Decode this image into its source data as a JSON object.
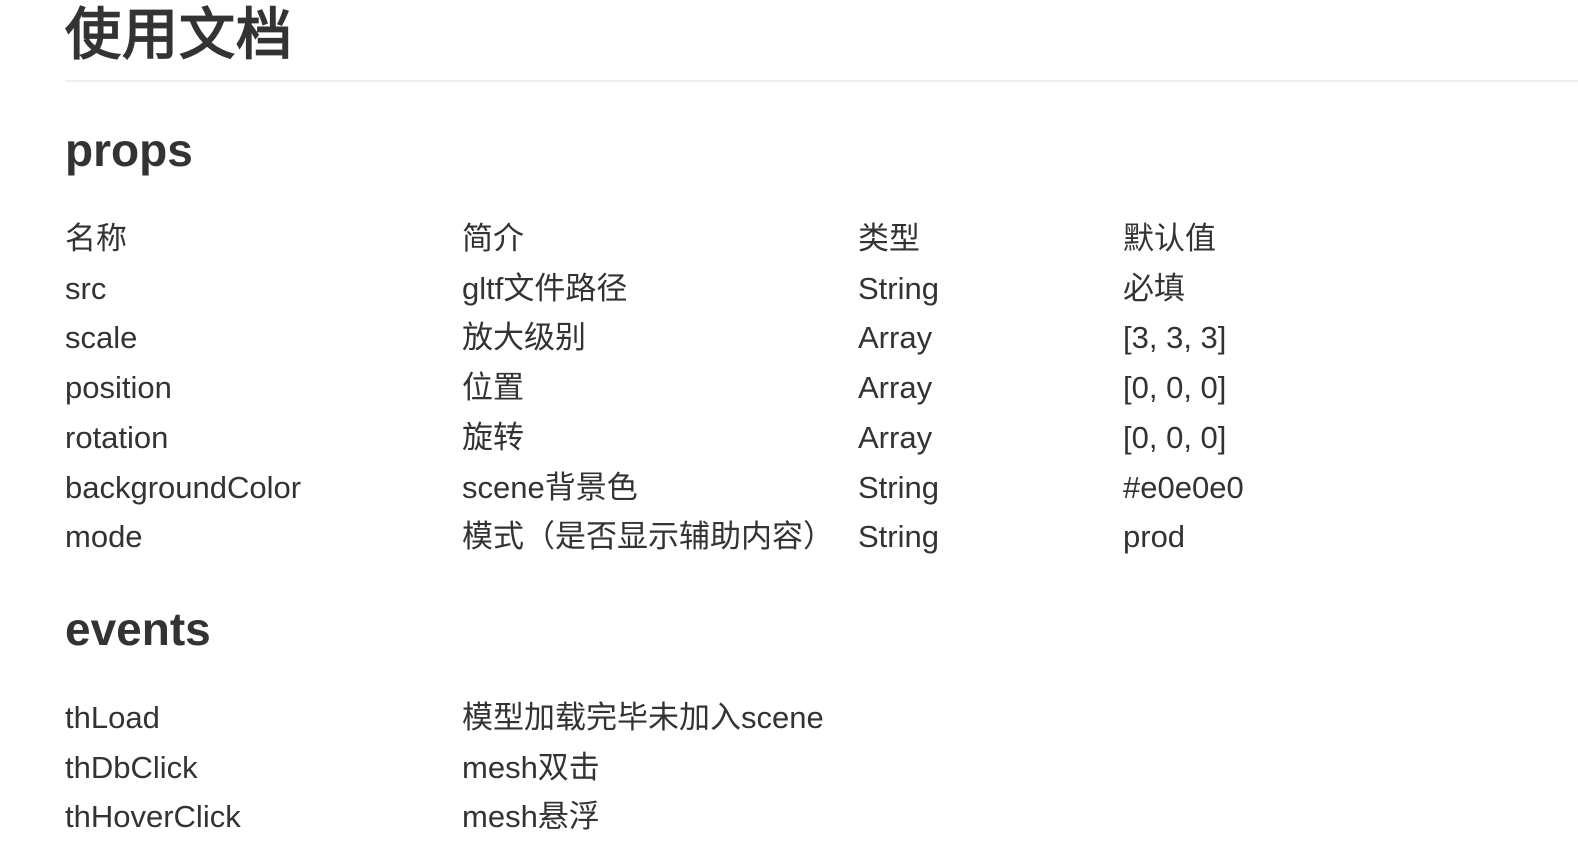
{
  "doc": {
    "title": "使用文档"
  },
  "props": {
    "heading": "props",
    "columns": [
      "名称",
      "简介",
      "类型",
      "默认值"
    ],
    "rows": [
      [
        "src",
        "gltf文件路径",
        "String",
        "必填"
      ],
      [
        "scale",
        "放大级别",
        "Array",
        "[3, 3, 3]"
      ],
      [
        "position",
        "位置",
        "Array",
        "[0, 0, 0]"
      ],
      [
        "rotation",
        "旋转",
        "Array",
        "[0, 0, 0]"
      ],
      [
        "backgroundColor",
        "scene背景色",
        "String",
        "#e0e0e0"
      ],
      [
        "mode",
        "模式（是否显示辅助内容）",
        "String",
        "prod"
      ]
    ]
  },
  "events": {
    "heading": "events",
    "rows": [
      [
        "thLoad",
        "模型加载完毕未加入scene"
      ],
      [
        "thDbClick",
        "mesh双击"
      ],
      [
        "thHoverClick",
        "mesh悬浮"
      ]
    ]
  }
}
